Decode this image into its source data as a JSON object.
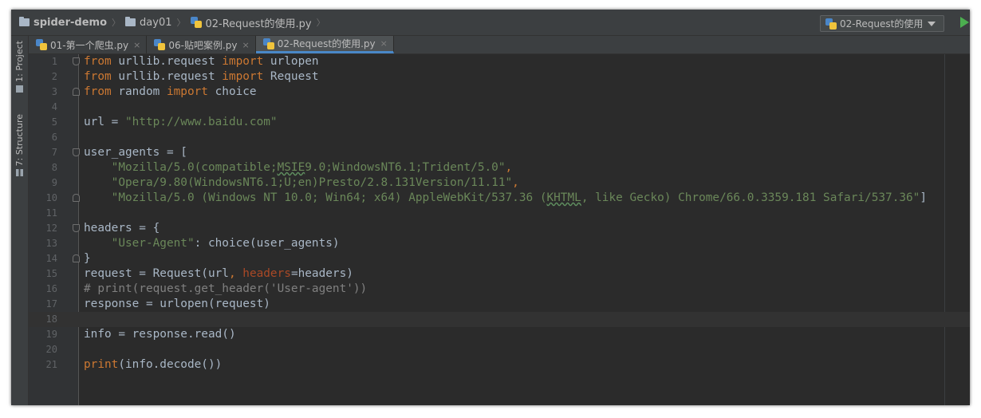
{
  "breadcrumbs": [
    {
      "label": "spider-demo",
      "icon": "folder-icon"
    },
    {
      "label": "day01",
      "icon": "folder-icon"
    },
    {
      "label": "02-Request的使用.py",
      "icon": "python-file-icon"
    }
  ],
  "run_config": {
    "label": "02-Request的使用"
  },
  "tool_windows": {
    "project": "1: Project",
    "structure": "7: Structure"
  },
  "tabs": [
    {
      "label": "01-第一个爬虫.py",
      "active": false
    },
    {
      "label": "06-贴吧案例.py",
      "active": false
    },
    {
      "label": "02-Request的使用.py",
      "active": true
    }
  ],
  "tab_close_glyph": "×",
  "editor": {
    "caret_line": 18,
    "lines": [
      {
        "num": "1"
      },
      {
        "num": "2"
      },
      {
        "num": "3"
      },
      {
        "num": "4"
      },
      {
        "num": "5"
      },
      {
        "num": "6"
      },
      {
        "num": "7"
      },
      {
        "num": "8"
      },
      {
        "num": "9"
      },
      {
        "num": "10"
      },
      {
        "num": "11"
      },
      {
        "num": "12"
      },
      {
        "num": "13"
      },
      {
        "num": "14"
      },
      {
        "num": "15"
      },
      {
        "num": "16"
      },
      {
        "num": "17"
      },
      {
        "num": "18"
      },
      {
        "num": "19"
      },
      {
        "num": "20"
      },
      {
        "num": "21"
      }
    ],
    "tokens": {
      "l1": [
        "from",
        " urllib.request ",
        "import",
        " urlopen"
      ],
      "l2": [
        "from",
        " urllib.request ",
        "import",
        " Request"
      ],
      "l3": [
        "from",
        " random ",
        "import",
        " choice"
      ],
      "l5": [
        "url = ",
        "\"http://www.baidu.com\""
      ],
      "l7": [
        "user_agents = ["
      ],
      "l8": [
        "    ",
        "\"Mozilla/5.0(compatible;",
        "MSIE",
        "9.0;WindowsNT6.1;Trident/5.0\"",
        ","
      ],
      "l9": [
        "    ",
        "\"Opera/9.80(WindowsNT6.1;U;en)Presto/2.8.131Version/11.11\"",
        ","
      ],
      "l10": [
        "    ",
        "\"Mozilla/5.0 (Windows NT 10.0; Win64; x64) AppleWebKit/537.36 (",
        "KHTML",
        ", like Gecko) Chrome/66.0.3359.181 Safari/537.36\"",
        "]"
      ],
      "l12": [
        "headers = {"
      ],
      "l13": [
        "    ",
        "\"User-Agent\"",
        ": choice(user_agents)"
      ],
      "l14": [
        "}"
      ],
      "l15": [
        "request = Request(url",
        ", ",
        "headers",
        "=headers)"
      ],
      "l16": [
        "# print(request.get_header('User-agent'))"
      ],
      "l17": [
        "response = urlopen(request)"
      ],
      "l19": [
        "info = response.read()"
      ],
      "l21": [
        "print",
        "(info.decode())"
      ]
    }
  },
  "colors": {
    "editor_bg": "#2b2b2b",
    "keyword": "#cc7832",
    "string": "#6a8759",
    "comment": "#808080",
    "identifier": "#a9b7c6",
    "kwarg": "#aa4926",
    "active_tab_underline": "#4a88c7"
  }
}
